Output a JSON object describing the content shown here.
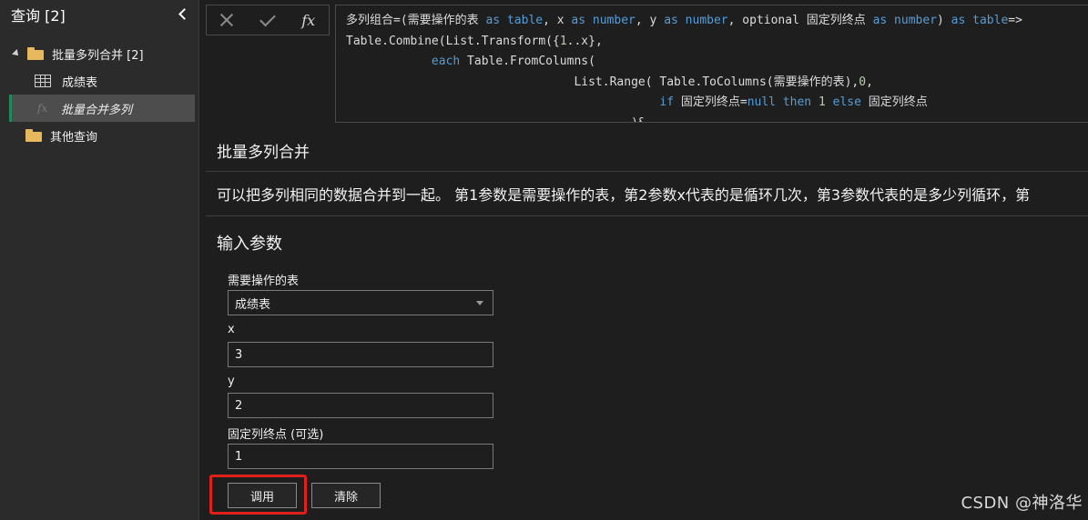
{
  "sidebar": {
    "title": "查询 [2]",
    "items": [
      {
        "label": "批量多列合并 [2]"
      },
      {
        "label": "成绩表"
      },
      {
        "label": "批量合并多列"
      },
      {
        "label": "其他查询"
      }
    ]
  },
  "formula": {
    "fx_label": "fx",
    "lines": [
      "多列组合=(需要操作的表 as table, x as number, y as number, optional 固定列终点 as number) as table=>",
      "Table.Combine(List.Transform({1..x},",
      "            each Table.FromColumns(",
      "                                List.Range( Table.ToColumns(需要操作的表),0,",
      "                                            if 固定列终点=null then 1 else 固定列终点",
      "                                        )&"
    ]
  },
  "function": {
    "title": "批量多列合并",
    "description": "可以把多列相同的数据合并到一起。 第1参数是需要操作的表，第2参数x代表的是循环几次，第3参数代表的是多少列循环，第"
  },
  "params": {
    "title": "输入参数",
    "table": {
      "label": "需要操作的表",
      "value": "成绩表"
    },
    "x": {
      "label": "x",
      "value": "3"
    },
    "y": {
      "label": "y",
      "value": "2"
    },
    "end": {
      "label": "固定列终点 (可选)",
      "value": "1"
    }
  },
  "buttons": {
    "invoke": "调用",
    "clear": "清除"
  },
  "watermark": "CSDN @神洛华",
  "colors": {
    "highlight": "#e0201c",
    "keyword": "#569cd6",
    "selected_accent": "#1e8a5a"
  }
}
